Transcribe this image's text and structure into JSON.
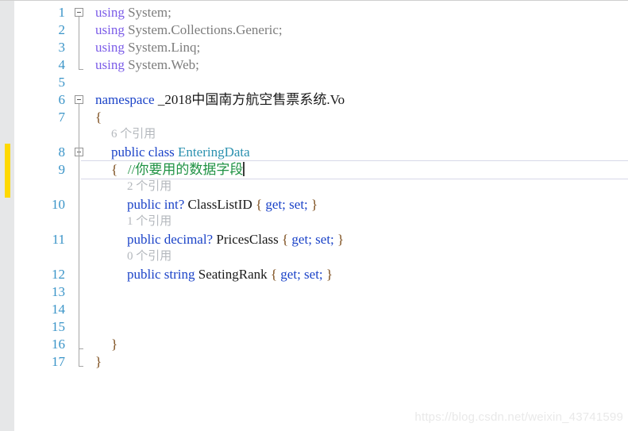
{
  "editor": {
    "app": "Visual Studio Code Editor",
    "language": "C#",
    "caret_line": 9,
    "colors": {
      "background": "#ffffff",
      "line_number": "#3a94c8",
      "change_bar_unsaved": "#ffd900",
      "keyword": "#1b43c8",
      "using_keyword": "#7b5ce8",
      "type_name": "#2b91af",
      "comment": "#1f9243",
      "codelens": "#b4b8bd",
      "indicator_margin": "#e6e7e8",
      "current_line_highlight": "#eceef7"
    }
  },
  "lines": [
    {
      "n": "1",
      "fold": "open",
      "indent": 0,
      "tokens": [
        {
          "t": "using",
          "c": "kw"
        },
        {
          "t": " ",
          "c": "punc"
        },
        {
          "t": "System;",
          "c": "ns"
        }
      ]
    },
    {
      "n": "2",
      "fold": "none",
      "indent": 0,
      "tokens": [
        {
          "t": "using",
          "c": "kw"
        },
        {
          "t": " ",
          "c": "punc"
        },
        {
          "t": "System.Collections.Generic;",
          "c": "ns"
        }
      ]
    },
    {
      "n": "3",
      "fold": "none",
      "indent": 0,
      "tokens": [
        {
          "t": "using",
          "c": "kw"
        },
        {
          "t": " ",
          "c": "punc"
        },
        {
          "t": "System.Linq;",
          "c": "ns"
        }
      ]
    },
    {
      "n": "4",
      "fold": "none",
      "indent": 0,
      "tokens": [
        {
          "t": "using",
          "c": "kw"
        },
        {
          "t": " ",
          "c": "punc"
        },
        {
          "t": "System.Web;",
          "c": "ns"
        }
      ]
    },
    {
      "n": "5",
      "fold": "none",
      "indent": 0,
      "tokens": []
    },
    {
      "n": "6",
      "fold": "open",
      "indent": 0,
      "tokens": [
        {
          "t": "namespace",
          "c": "nsname"
        },
        {
          "t": " ",
          "c": "punc"
        },
        {
          "t": "_2018中国南方航空售票系统.Vo",
          "c": "ident"
        }
      ]
    },
    {
      "n": "7",
      "fold": "none",
      "indent": 0,
      "tokens": [
        {
          "t": "{",
          "c": "brace"
        }
      ]
    },
    {
      "n": "8",
      "fold": "open",
      "indent": 1,
      "tokens": [
        {
          "t": "public",
          "c": "kw2"
        },
        {
          "t": " ",
          "c": "punc"
        },
        {
          "t": "class",
          "c": "kw2"
        },
        {
          "t": " ",
          "c": "punc"
        },
        {
          "t": "EnteringData",
          "c": "type"
        }
      ]
    },
    {
      "n": "9",
      "fold": "none",
      "indent": 1,
      "tokens": [
        {
          "t": "{",
          "c": "brace"
        },
        {
          "t": "   ",
          "c": "punc"
        },
        {
          "t": "//你要用的数据字段",
          "c": "cmt"
        }
      ],
      "caret": true
    },
    {
      "n": "10",
      "fold": "none",
      "indent": 2,
      "tokens": [
        {
          "t": "public",
          "c": "kw2"
        },
        {
          "t": " ",
          "c": "punc"
        },
        {
          "t": "int?",
          "c": "kw2"
        },
        {
          "t": " ",
          "c": "punc"
        },
        {
          "t": "ClassListID",
          "c": "ident"
        },
        {
          "t": " ",
          "c": "punc"
        },
        {
          "t": "{",
          "c": "brace"
        },
        {
          "t": " ",
          "c": "punc"
        },
        {
          "t": "get;",
          "c": "kw2"
        },
        {
          "t": " ",
          "c": "punc"
        },
        {
          "t": "set;",
          "c": "kw2"
        },
        {
          "t": " ",
          "c": "punc"
        },
        {
          "t": "}",
          "c": "brace"
        }
      ]
    },
    {
      "n": "11",
      "fold": "none",
      "indent": 2,
      "tokens": [
        {
          "t": "public",
          "c": "kw2"
        },
        {
          "t": " ",
          "c": "punc"
        },
        {
          "t": "decimal?",
          "c": "kw2"
        },
        {
          "t": " ",
          "c": "punc"
        },
        {
          "t": "PricesClass",
          "c": "ident"
        },
        {
          "t": " ",
          "c": "punc"
        },
        {
          "t": "{",
          "c": "brace"
        },
        {
          "t": " ",
          "c": "punc"
        },
        {
          "t": "get;",
          "c": "kw2"
        },
        {
          "t": " ",
          "c": "punc"
        },
        {
          "t": "set;",
          "c": "kw2"
        },
        {
          "t": " ",
          "c": "punc"
        },
        {
          "t": "}",
          "c": "brace"
        }
      ]
    },
    {
      "n": "12",
      "fold": "none",
      "indent": 2,
      "tokens": [
        {
          "t": "public",
          "c": "kw2"
        },
        {
          "t": " ",
          "c": "punc"
        },
        {
          "t": "string",
          "c": "kw2"
        },
        {
          "t": " ",
          "c": "punc"
        },
        {
          "t": "SeatingRank",
          "c": "ident"
        },
        {
          "t": " ",
          "c": "punc"
        },
        {
          "t": "{",
          "c": "brace"
        },
        {
          "t": " ",
          "c": "punc"
        },
        {
          "t": "get;",
          "c": "kw2"
        },
        {
          "t": " ",
          "c": "punc"
        },
        {
          "t": "set;",
          "c": "kw2"
        },
        {
          "t": " ",
          "c": "punc"
        },
        {
          "t": "}",
          "c": "brace"
        }
      ]
    },
    {
      "n": "13",
      "fold": "none",
      "indent": 0,
      "tokens": []
    },
    {
      "n": "14",
      "fold": "none",
      "indent": 0,
      "tokens": []
    },
    {
      "n": "15",
      "fold": "none",
      "indent": 0,
      "tokens": []
    },
    {
      "n": "16",
      "fold": "none",
      "indent": 1,
      "tokens": [
        {
          "t": "}",
          "c": "brace"
        }
      ]
    },
    {
      "n": "17",
      "fold": "none",
      "indent": 0,
      "tokens": [
        {
          "t": "}",
          "c": "brace"
        }
      ]
    }
  ],
  "codelens": [
    {
      "label": "6 个引用",
      "for_line": "8",
      "indent": 1
    },
    {
      "label": "2 个引用",
      "for_line": "10",
      "indent": 2
    },
    {
      "label": "1 个引用",
      "for_line": "11",
      "indent": 2
    },
    {
      "label": "0 个引用",
      "for_line": "12",
      "indent": 2
    }
  ],
  "watermark": {
    "text": "https://blog.csdn.net/weixin_43741599"
  }
}
